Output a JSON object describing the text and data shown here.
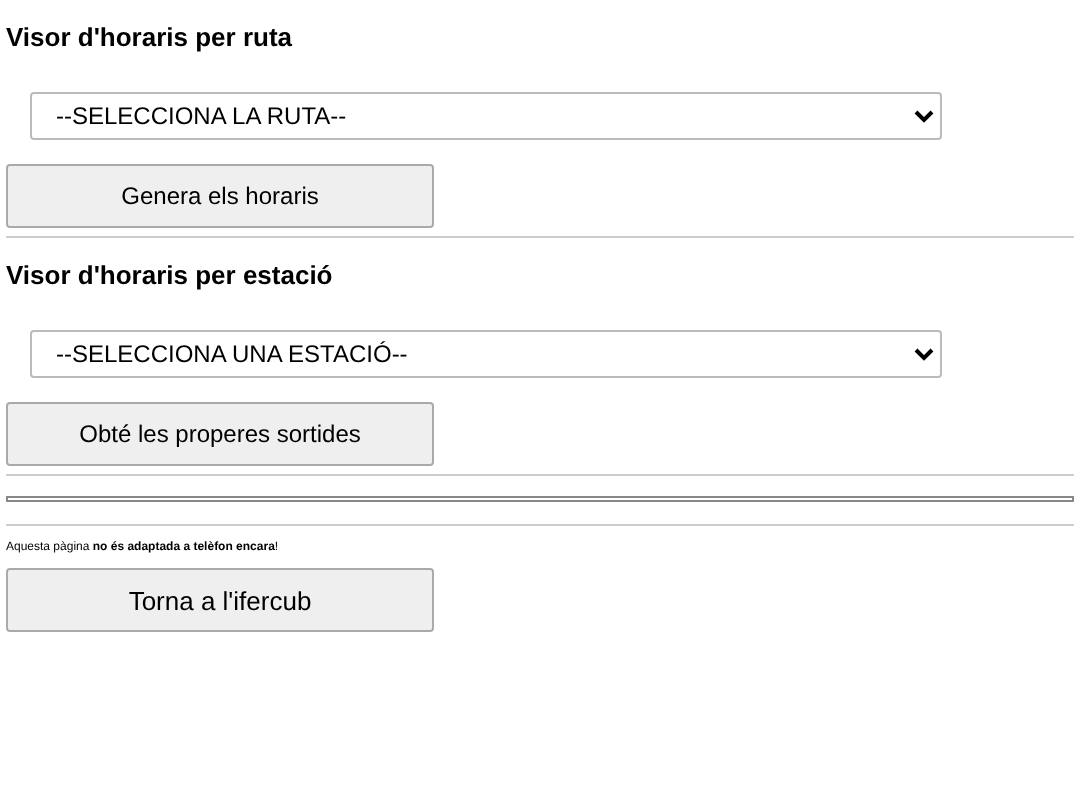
{
  "sections": [
    {
      "heading": "Visor d'horaris per ruta",
      "select": {
        "value": "--SELECCIONA LA RUTA--"
      },
      "button": "Genera els horaris"
    },
    {
      "heading": "Visor d'horaris per estació",
      "select": {
        "value": "--SELECCIONA UNA ESTACIÓ--"
      },
      "button": "Obté les properes sortides"
    }
  ],
  "notice": "Aquesta pàgina **no és adaptada a telèfon encara**!",
  "back_button": "Torna a l'ifercub"
}
